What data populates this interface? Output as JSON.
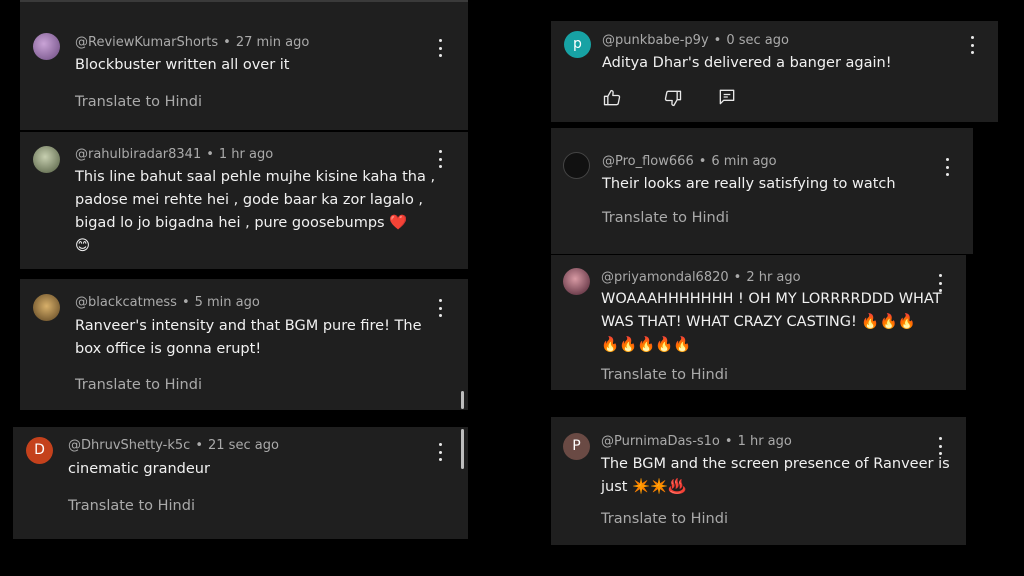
{
  "comments": [
    {
      "id": "c1",
      "handle": "@ReviewKumarShorts",
      "dot": "•",
      "time": "27 min ago",
      "lines": [
        "Blockbuster written all over it"
      ],
      "translate": "Translate to Hindi",
      "avatar": {
        "letter": "",
        "color": "#8b6a9a"
      }
    },
    {
      "id": "c2",
      "handle": "@rahulbiradar8341",
      "dot": "•",
      "time": "1 hr ago",
      "lines": [
        "This line bahut saal pehle mujhe kisine kaha tha ,",
        "padose mei rehte hei , gode baar ka zor lagalo ,",
        "bigad lo jo bigadna hei , pure goosebumps ❤️",
        "😊"
      ],
      "translate": "",
      "avatar": {
        "letter": "",
        "color": "#7a8a6a"
      }
    },
    {
      "id": "c3",
      "handle": "@blackcatmess",
      "dot": "•",
      "time": "5 min ago",
      "lines": [
        "Ranveer's intensity and that BGM pure fire! The",
        "box office is gonna erupt!"
      ],
      "translate": "Translate to Hindi",
      "avatar": {
        "letter": "",
        "color": "#9a7d4a"
      }
    },
    {
      "id": "c4",
      "handle": "@DhruvShetty-k5c",
      "dot": "•",
      "time": "21 sec ago",
      "lines": [
        "cinematic grandeur"
      ],
      "translate": "Translate to Hindi",
      "avatar": {
        "letter": "D",
        "color": "#c4411c"
      }
    },
    {
      "id": "c5",
      "handle": "@punkbabe-p9y",
      "dot": "•",
      "time": "0 sec ago",
      "lines": [
        "Aditya Dhar's delivered a banger again!"
      ],
      "translate": "",
      "avatar": {
        "letter": "p",
        "color": "#17a2a4"
      }
    },
    {
      "id": "c6",
      "handle": "@Pro_flow666",
      "dot": "•",
      "time": "6 min ago",
      "lines": [
        "Their looks are really satisfying to watch"
      ],
      "translate": "Translate to Hindi",
      "avatar": {
        "letter": "",
        "color": "#2a2a2a"
      }
    },
    {
      "id": "c7",
      "handle": "@priyamondal6820",
      "dot": "•",
      "time": "2 hr ago",
      "lines": [
        "WOAAAHHHHHHH ! OH MY LORRRRDDD WHAT",
        "WAS THAT! WHAT CRAZY CASTING! 🔥🔥🔥",
        "🔥🔥🔥🔥🔥"
      ],
      "translate": "Translate to Hindi",
      "avatar": {
        "letter": "",
        "color": "#6b3b4a"
      }
    },
    {
      "id": "c8",
      "handle": "@PurnimaDas-s1o",
      "dot": "•",
      "time": "1 hr ago",
      "lines": [
        "The BGM and the screen presence of Ranveer is",
        "just ✴️✴️♨️"
      ],
      "translate": "Translate to Hindi",
      "avatar": {
        "letter": "P",
        "color": "#6a4a44"
      }
    }
  ],
  "actions": {
    "like": "like-icon",
    "dislike": "dislike-icon",
    "reply": "reply-icon"
  }
}
